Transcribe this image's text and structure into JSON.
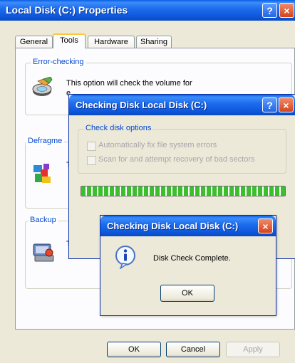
{
  "main_window": {
    "title": "Local Disk (C:) Properties",
    "help_glyph": "?",
    "close_glyph": "×",
    "tabs": [
      {
        "label": "General",
        "active": false
      },
      {
        "label": "Tools",
        "active": true
      },
      {
        "label": "Hardware",
        "active": false
      },
      {
        "label": "Sharing",
        "active": false
      }
    ],
    "sections": {
      "error_checking": {
        "label": "Error-checking",
        "text": "This option will check the volume for",
        "text2": "e",
        "icon": "disk-check-icon"
      },
      "defrag": {
        "label": "Defragme",
        "text": "T",
        "icon": "defrag-icon"
      },
      "backup": {
        "label": "Backup",
        "text": "T",
        "icon": "backup-icon"
      }
    },
    "buttons": {
      "ok": "OK",
      "cancel": "Cancel",
      "apply": "Apply"
    }
  },
  "check_disk_dialog": {
    "title": "Checking Disk Local Disk (C:)",
    "group_label": "Check disk options",
    "options": [
      {
        "label": "Automatically fix file system errors",
        "checked": false,
        "enabled": false
      },
      {
        "label": "Scan for and attempt recovery of bad sectors",
        "checked": false,
        "enabled": false
      }
    ],
    "progress_fraction": 1.0
  },
  "message_box": {
    "title": "Checking Disk Local Disk (C:)",
    "message": "Disk Check Complete.",
    "ok_label": "OK",
    "icon": "info-icon"
  },
  "colors": {
    "title_blue": "#0b54d8",
    "face": "#ece9d8",
    "group_label": "#0046d5",
    "progress_green": "#3bbf2d",
    "close_red": "#d6431c"
  }
}
